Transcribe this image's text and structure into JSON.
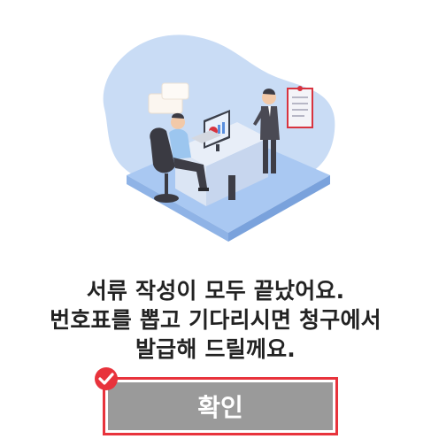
{
  "message": {
    "line1": "서류 작성이 모두 끝났어요.",
    "line2": "번호표를 뽑고 기다리시면 청구에서",
    "line3": "발급해 드릴께요."
  },
  "confirm": {
    "label": "확인"
  },
  "icons": {
    "illustration": "office-consultation-illustration",
    "badge": "checkmark-badge-icon"
  },
  "colors": {
    "highlight": "#e8333c",
    "button_bg": "#9a9a9a",
    "button_text": "#ffffff",
    "text": "#222222",
    "blob": "#c9dcf5"
  }
}
